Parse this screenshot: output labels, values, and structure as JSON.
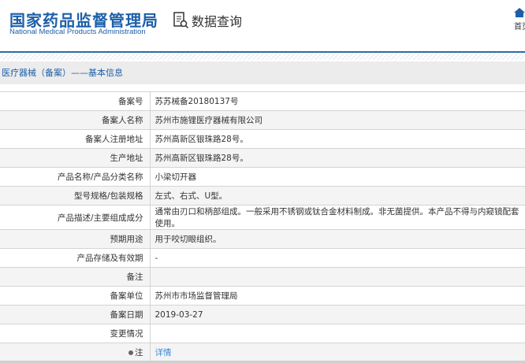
{
  "header": {
    "logo_cn": "国家药品监督管理局",
    "logo_en": "National Medical Products Administration",
    "query_label": "数据查询",
    "home_label": "首页"
  },
  "title": "医疗器械（备案）——基本信息",
  "rows": [
    {
      "label": "备案号",
      "value": "苏苏械备20180137号"
    },
    {
      "label": "备案人名称",
      "value": "苏州市施锂医疗器械有限公司"
    },
    {
      "label": "备案人注册地址",
      "value": "苏州高新区银珠路28号。"
    },
    {
      "label": "生产地址",
      "value": "苏州高新区银珠路28号。"
    },
    {
      "label": "产品名称/产品分类名称",
      "value": "小梁切开器"
    },
    {
      "label": "型号规格/包装规格",
      "value": "左式、右式、U型。"
    },
    {
      "label": "产品描述/主要组成成分",
      "value": "通常由刃口和柄部组成。一般采用不锈钢或钛合金材料制成。非无菌提供。本产品不得与内窥镜配套使用。"
    },
    {
      "label": "预期用途",
      "value": "用于咬切眼组织。"
    },
    {
      "label": "产品存储及有效期",
      "value": "-"
    },
    {
      "label": "备注",
      "value": ""
    },
    {
      "label": "备案单位",
      "value": "苏州市市场监督管理局"
    },
    {
      "label": "备案日期",
      "value": "2019-03-27"
    },
    {
      "label": "变更情况",
      "value": ""
    }
  ],
  "note": {
    "label": "注",
    "link": "详情"
  }
}
